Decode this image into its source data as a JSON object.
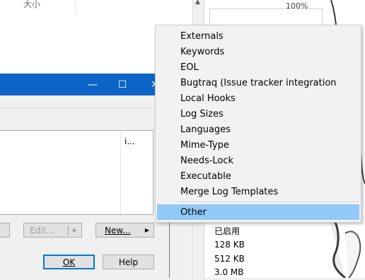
{
  "background": {
    "header_text": "大小",
    "progress_text": "100%",
    "values": [
      "已启用",
      "128 KB",
      "512 KB",
      "3.0 MB"
    ]
  },
  "dialog": {
    "title_buttons": {
      "minimize": "—",
      "maximize": "☐",
      "close": "✕"
    },
    "list_column_text": "i...",
    "edit_button": "Edit...",
    "new_button": "New...",
    "ok_button": "OK",
    "help_button": "Help"
  },
  "menu": {
    "items": [
      "Externals",
      "Keywords",
      "EOL",
      "Bugtraq (Issue tracker integration",
      "Local Hooks",
      "Log Sizes",
      "Languages",
      "Mime-Type",
      "Needs-Lock",
      "Executable",
      "Merge Log Templates"
    ],
    "selected_item": "Other"
  },
  "colors": {
    "titlebar": "#0b64c6",
    "menu_selected": "#91c9f7",
    "menu_bg": "#f2f2f2"
  }
}
